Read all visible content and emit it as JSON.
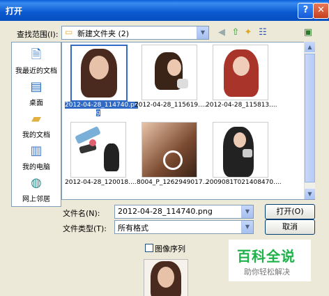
{
  "window": {
    "title": "打开",
    "help": "?",
    "close": "✕"
  },
  "lookin": {
    "label": "查找范围(I):",
    "value": "新建文件夹 (2)"
  },
  "places": [
    {
      "label": "我最近的文档",
      "icon": "recent-documents-icon"
    },
    {
      "label": "桌面",
      "icon": "desktop-icon"
    },
    {
      "label": "我的文档",
      "icon": "my-documents-icon"
    },
    {
      "label": "我的电脑",
      "icon": "my-computer-icon"
    },
    {
      "label": "网上邻居",
      "icon": "network-places-icon"
    }
  ],
  "files": [
    {
      "name_l1": "2012-04-28_114740.pn",
      "name_l2": "g",
      "selected": true
    },
    {
      "name_l1": "2012-04-28_115619....",
      "name_l2": ""
    },
    {
      "name_l1": "2012-04-28_115813....",
      "name_l2": ""
    },
    {
      "name_l1": "2012-04-28_120018....",
      "name_l2": ""
    },
    {
      "name_l1": "8004_P_1262949017...",
      "name_l2": ""
    },
    {
      "name_l1": "2009081T021408470....",
      "name_l2": ""
    }
  ],
  "filename": {
    "label": "文件名(N):",
    "value": "2012-04-28_114740.png"
  },
  "filetype": {
    "label": "文件类型(T):",
    "value": "所有格式"
  },
  "buttons": {
    "open": "打开(O)",
    "cancel": "取消"
  },
  "sequence_label": "图像序列",
  "watermark": {
    "title": "百科全说",
    "subtitle": "助你轻松解决"
  }
}
